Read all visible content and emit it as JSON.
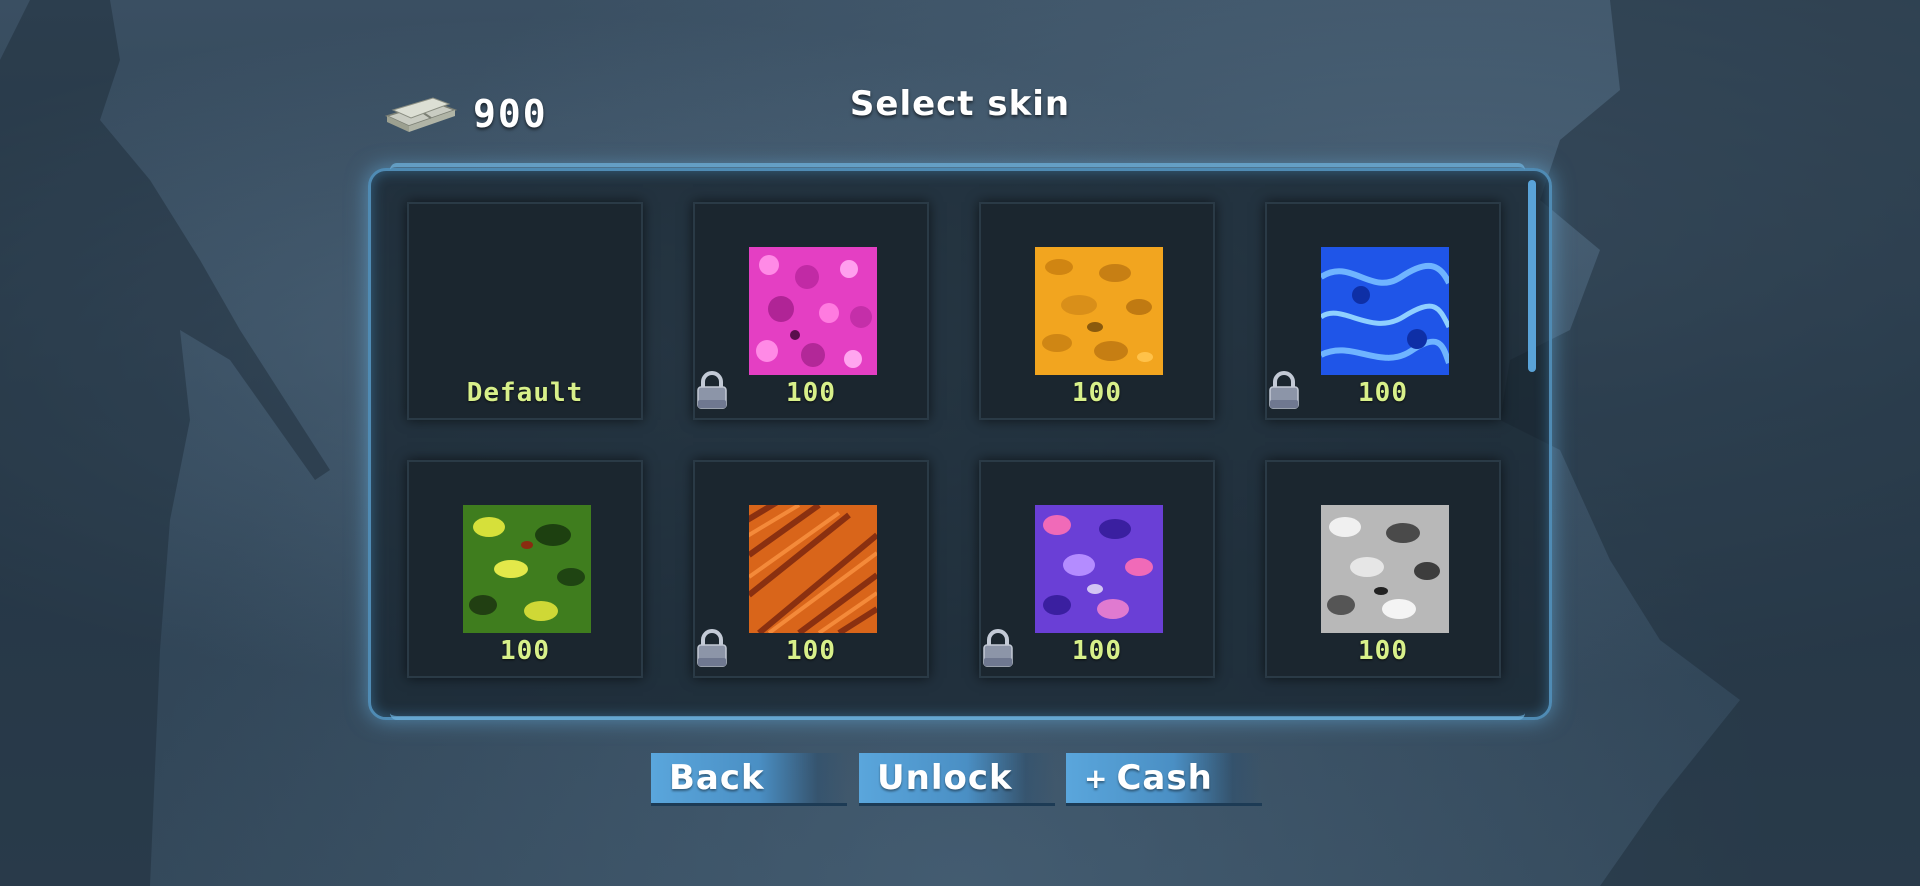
{
  "header": {
    "cash_amount": "900",
    "title": "Select skin",
    "cash_icon": "money-stack-icon"
  },
  "skins": [
    {
      "label": "Default",
      "swatch": null,
      "locked": false
    },
    {
      "label": "100",
      "swatch": "pink-camo",
      "locked": true
    },
    {
      "label": "100",
      "swatch": "orange-camo",
      "locked": false
    },
    {
      "label": "100",
      "swatch": "blue-camo",
      "locked": true
    },
    {
      "label": "100",
      "swatch": "green-camo",
      "locked": false
    },
    {
      "label": "100",
      "swatch": "rust-camo",
      "locked": true
    },
    {
      "label": "100",
      "swatch": "purple-camo",
      "locked": true
    },
    {
      "label": "100",
      "swatch": "grey-camo",
      "locked": false
    }
  ],
  "buttons": {
    "back": "Back",
    "unlock": "Unlock",
    "cash_plus": "+",
    "cash": "Cash"
  },
  "colors": {
    "accent": "#5aa6dc",
    "price": "#d8f08a",
    "panel_border": "#4f8bb4"
  }
}
